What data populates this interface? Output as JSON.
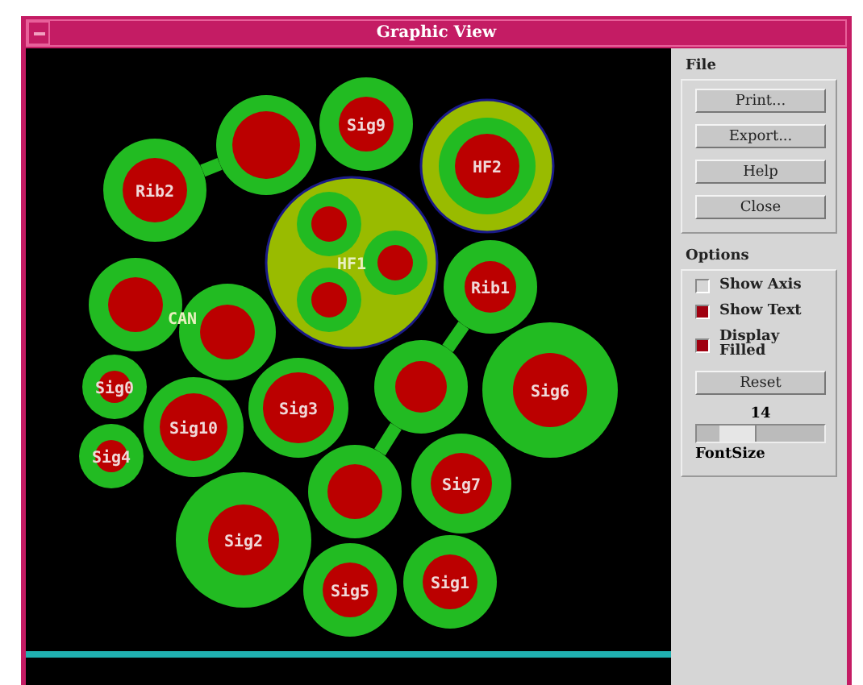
{
  "window": {
    "title": "Graphic View"
  },
  "graph": {
    "nodes": [
      {
        "kind": "signal",
        "label": "Rib2"
      },
      {
        "kind": "signal"
      },
      {
        "kind": "signal",
        "label": "Sig9"
      },
      {
        "kind": "group",
        "label": "HF2"
      },
      {
        "kind": "cluster",
        "label": "HF1"
      },
      {
        "kind": "signal",
        "label": "Rib1"
      },
      {
        "kind": "signal"
      },
      {
        "kind": "signal"
      },
      {
        "kind": "signal",
        "label": "Sig0"
      },
      {
        "kind": "signal",
        "label": "Sig10"
      },
      {
        "kind": "signal",
        "label": "Sig3"
      },
      {
        "kind": "signal"
      },
      {
        "kind": "signal",
        "label": "Sig6"
      },
      {
        "kind": "signal",
        "label": "Sig4"
      },
      {
        "kind": "signal"
      },
      {
        "kind": "signal",
        "label": "Sig7"
      },
      {
        "kind": "signal",
        "label": "Sig2"
      },
      {
        "kind": "signal",
        "label": "Sig5"
      },
      {
        "kind": "signal",
        "label": "Sig1"
      }
    ],
    "free_label": "CAN"
  },
  "file_section": {
    "title": "File",
    "buttons": [
      "Print...",
      "Export...",
      "Help",
      "Close"
    ]
  },
  "options_section": {
    "title": "Options",
    "checkboxes": [
      {
        "label": "Show Axis",
        "checked": false
      },
      {
        "label": "Show Text",
        "checked": true
      },
      {
        "label": "Display Filled",
        "checked": true
      }
    ],
    "reset_button": "Reset",
    "font_size": {
      "value": "14",
      "level": 0.25,
      "label": "FontSize"
    }
  }
}
